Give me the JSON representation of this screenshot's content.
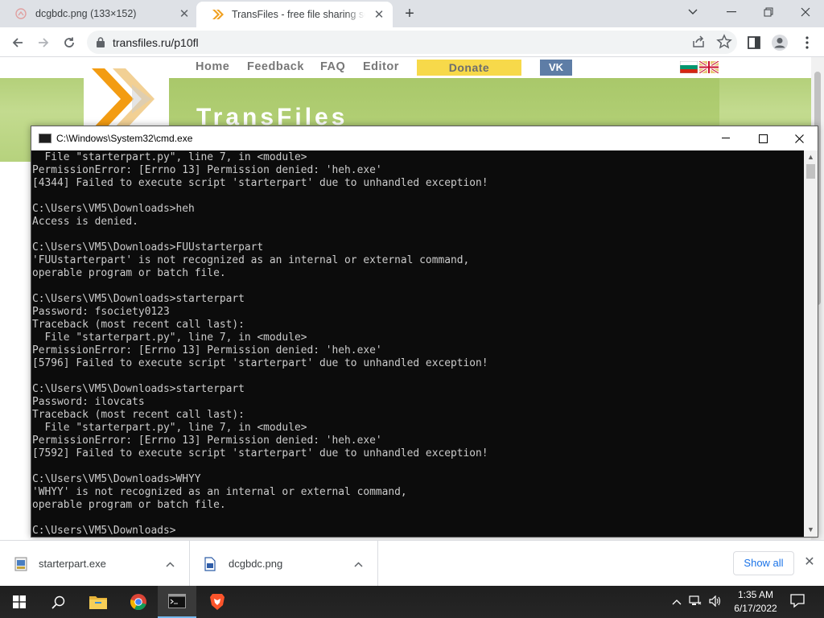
{
  "browser": {
    "tabs": [
      {
        "title": "dcgbdc.png (133×152)",
        "active": false
      },
      {
        "title": "TransFiles - free file sharing service",
        "active": true
      }
    ],
    "new_tab_label": "+",
    "address": "transfiles.ru/p10fl"
  },
  "site": {
    "nav": [
      "Home",
      "Feedback",
      "FAQ",
      "Editor"
    ],
    "donate_label": "Donate",
    "vk_label": "VK",
    "title": "TransFiles",
    "colors": {
      "green": "#b4d07a",
      "donate": "#f7d94a",
      "vk": "#5e7da6",
      "logo_orange": "#f39c12"
    }
  },
  "cmd": {
    "title": "C:\\Windows\\System32\\cmd.exe",
    "lines": [
      "  File \"starterpart.py\", line 7, in <module>",
      "PermissionError: [Errno 13] Permission denied: 'heh.exe'",
      "[4344] Failed to execute script 'starterpart' due to unhandled exception!",
      "",
      "C:\\Users\\VM5\\Downloads>heh",
      "Access is denied.",
      "",
      "C:\\Users\\VM5\\Downloads>FUUstarterpart",
      "'FUUstarterpart' is not recognized as an internal or external command,",
      "operable program or batch file.",
      "",
      "C:\\Users\\VM5\\Downloads>starterpart",
      "Password: fsociety0123",
      "Traceback (most recent call last):",
      "  File \"starterpart.py\", line 7, in <module>",
      "PermissionError: [Errno 13] Permission denied: 'heh.exe'",
      "[5796] Failed to execute script 'starterpart' due to unhandled exception!",
      "",
      "C:\\Users\\VM5\\Downloads>starterpart",
      "Password: ilovcats",
      "Traceback (most recent call last):",
      "  File \"starterpart.py\", line 7, in <module>",
      "PermissionError: [Errno 13] Permission denied: 'heh.exe'",
      "[7592] Failed to execute script 'starterpart' due to unhandled exception!",
      "",
      "C:\\Users\\VM5\\Downloads>WHYY",
      "'WHYY' is not recognized as an internal or external command,",
      "operable program or batch file.",
      "",
      "C:\\Users\\VM5\\Downloads>"
    ]
  },
  "downloads": {
    "items": [
      {
        "name": "starterpart.exe",
        "icon": "exe-file-icon"
      },
      {
        "name": "dcgbdc.png",
        "icon": "image-file-icon"
      }
    ],
    "show_all_label": "Show all"
  },
  "taskbar": {
    "apps": [
      "start-icon",
      "search-icon",
      "file-explorer-icon",
      "chrome-icon",
      "cmd-icon",
      "brave-icon"
    ],
    "time": "1:35 AM",
    "date": "6/17/2022"
  }
}
